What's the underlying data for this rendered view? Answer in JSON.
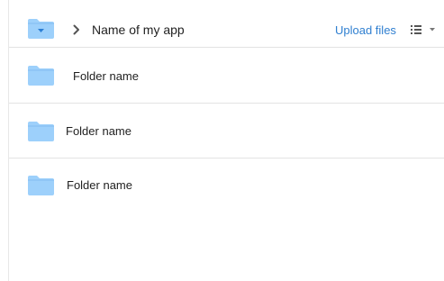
{
  "header": {
    "folder_icon": "folder-dropdown-icon",
    "breadcrumb_separator_icon": "chevron-right-icon",
    "app_name": "Name of my app",
    "upload_label": "Upload files",
    "view_toggle_icon": "list-view-icon",
    "view_toggle_caret_icon": "caret-down-icon"
  },
  "colors": {
    "folder": "#9dd0fb",
    "folder_dark": "#82bdf0",
    "folder_caret": "#2c7fd6",
    "link": "#2f7fd0",
    "divider": "#e3e3e3"
  },
  "folders": [
    {
      "icon": "folder-icon",
      "name": "Folder name"
    },
    {
      "icon": "folder-icon",
      "name": "Folder name"
    },
    {
      "icon": "folder-icon",
      "name": "Folder name"
    }
  ]
}
